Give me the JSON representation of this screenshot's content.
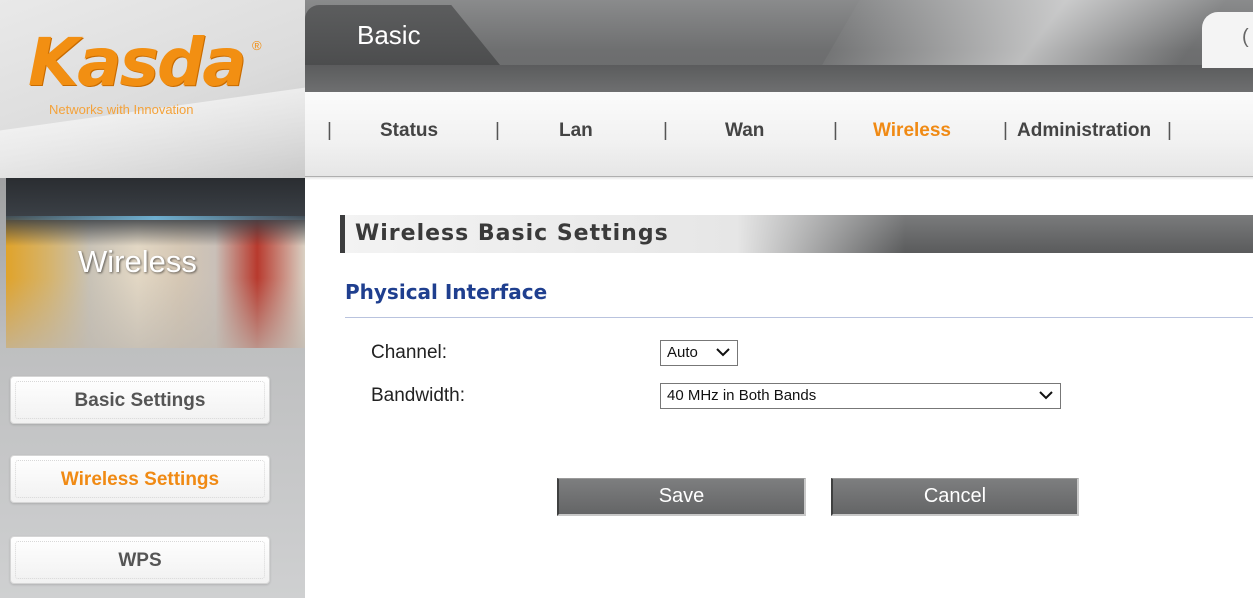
{
  "brand": {
    "name": "Kasda",
    "registered": "®",
    "tagline": "Networks with Innovation",
    "accent_color": "#f28f12"
  },
  "top_tabs": {
    "active": "Basic",
    "partial_right": "("
  },
  "nav": {
    "items": [
      {
        "label": "Status",
        "active": false
      },
      {
        "label": "Lan",
        "active": false
      },
      {
        "label": "Wan",
        "active": false
      },
      {
        "label": "Wireless",
        "active": true
      },
      {
        "label": "Administration",
        "active": false
      }
    ],
    "separator": "|"
  },
  "sidebar": {
    "section_title": "Wireless",
    "items": [
      {
        "label": "Basic Settings",
        "active": false
      },
      {
        "label": "Wireless Settings",
        "active": true
      },
      {
        "label": "WPS",
        "active": false
      }
    ]
  },
  "content": {
    "title": "Wireless Basic Settings",
    "subsection": "Physical Interface",
    "fields": {
      "channel": {
        "label": "Channel:",
        "value": "Auto"
      },
      "bandwidth": {
        "label": "Bandwidth:",
        "value": "40 MHz in Both Bands"
      }
    },
    "buttons": {
      "save": "Save",
      "cancel": "Cancel"
    }
  }
}
